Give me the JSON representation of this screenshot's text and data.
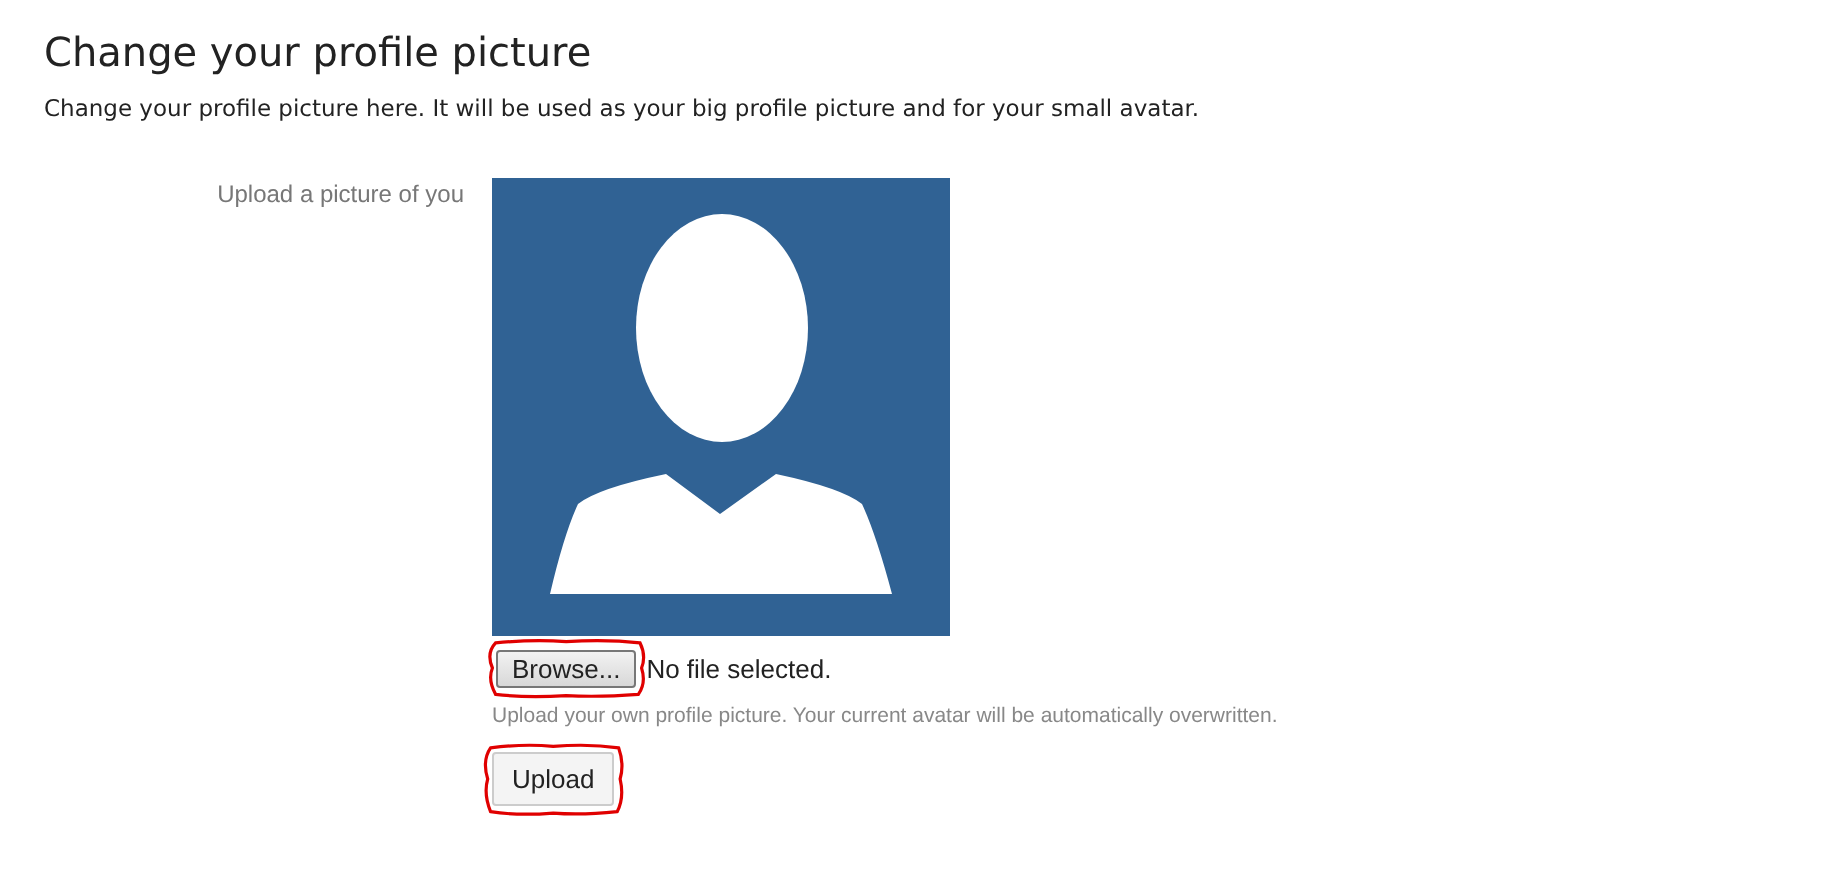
{
  "title": "Change your profile picture",
  "description": "Change your profile picture here. It will be used as your big profile picture and for your small avatar.",
  "form": {
    "label": "Upload a picture of you",
    "file_input": {
      "button": "Browse...",
      "status": "No file selected.",
      "annotated": true
    },
    "help_text": "Upload your own profile picture. Your current avatar will be automatically overwritten.",
    "upload_button": {
      "label": "Upload",
      "annotated": true
    }
  }
}
